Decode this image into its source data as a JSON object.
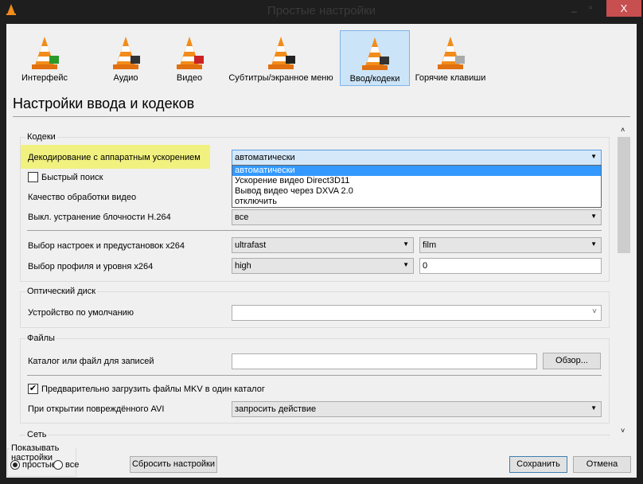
{
  "window": {
    "title": "Простые настройки",
    "close_label": "X"
  },
  "tabs": [
    {
      "label": "Интерфейс",
      "icon": "interface-cone-icon"
    },
    {
      "label": "Аудио",
      "icon": "audio-cone-icon"
    },
    {
      "label": "Видео",
      "icon": "video-cone-icon"
    },
    {
      "label": "Субтитры/экранное меню",
      "icon": "subtitles-cone-icon"
    },
    {
      "label": "Ввод/кодеки",
      "icon": "input-codecs-cone-icon",
      "selected": true
    },
    {
      "label": "Горячие клавиши",
      "icon": "hotkeys-cone-icon"
    }
  ],
  "page_title": "Настройки ввода и кодеков",
  "codecs": {
    "group": "Кодеки",
    "hw_label": "Декодирование с аппаратным ускорением",
    "hw_value": "автоматически",
    "hw_options": [
      "автоматически",
      "Ускорение видео Direct3D11",
      "Вывод видео через DXVA 2.0",
      "отключить"
    ],
    "fast_seek": "Быстрый поиск",
    "fast_seek_checked": false,
    "quality_label": "Качество обработки видео",
    "h264_label": "Выкл. устранение блочности H.264",
    "h264_value": "все",
    "x264_preset_label": "Выбор настроек и предустановок x264",
    "x264_preset": "ultrafast",
    "x264_tune": "film",
    "x264_profile_label": "Выбор профиля и уровня x264",
    "x264_profile": "high",
    "x264_level": "0"
  },
  "optical": {
    "group": "Оптический диск",
    "device_label": "Устройство по умолчанию",
    "device_value": ""
  },
  "files": {
    "group": "Файлы",
    "record_label": "Каталог или файл для записей",
    "record_value": "",
    "browse": "Обзор...",
    "mkv_label": "Предварительно загрузить файлы MKV в один каталог",
    "mkv_checked": true,
    "avi_label": "При открытии повреждённого AVI",
    "avi_value": "запросить действие"
  },
  "network": {
    "group": "Сеть"
  },
  "footer": {
    "show_group": "Показывать настройки",
    "simple": "простые",
    "all": "все",
    "selected": "простые",
    "reset": "Сбросить настройки",
    "save": "Сохранить",
    "cancel": "Отмена"
  },
  "colors": {
    "highlight": "#f1f180",
    "selection": "#3399ff",
    "close": "#c74f4f",
    "selected_tab": "#cce4f7"
  }
}
